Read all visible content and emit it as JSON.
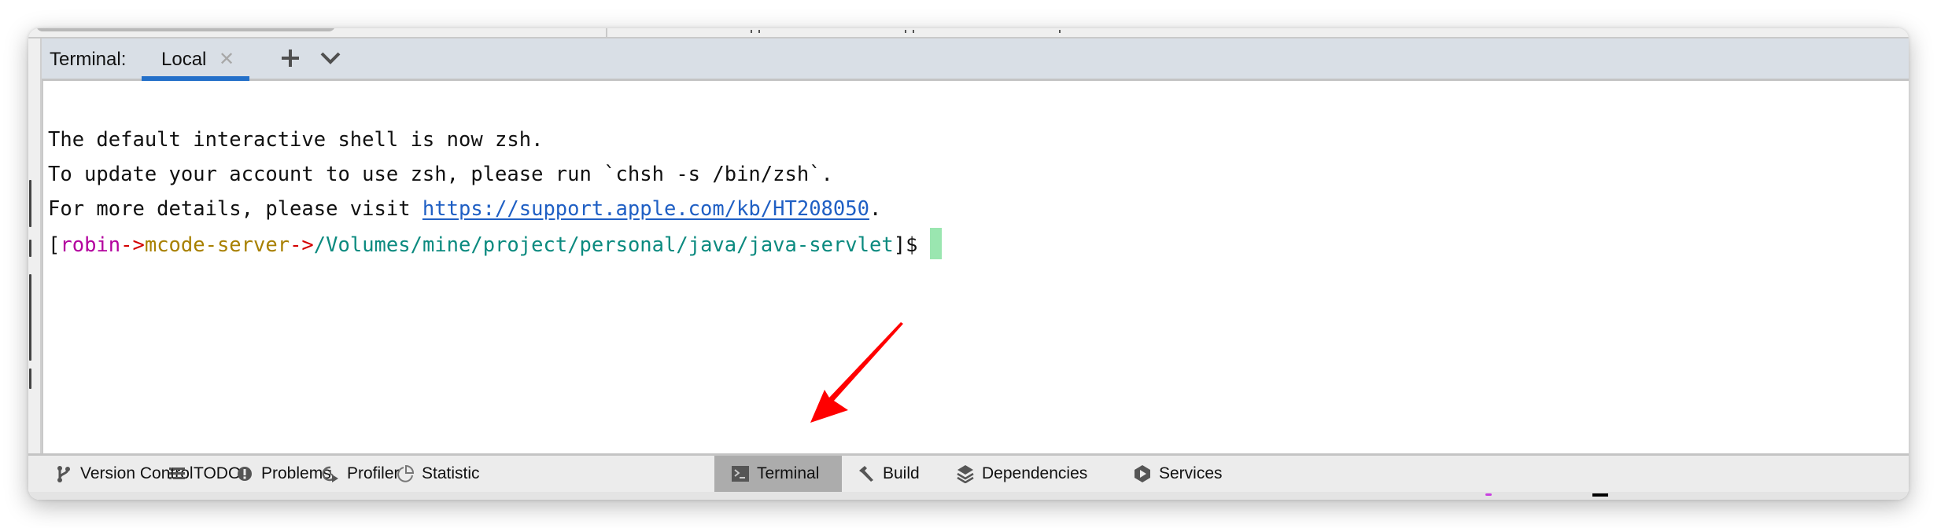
{
  "terminal_panel": {
    "label": "Terminal:",
    "tabs": [
      {
        "label": "Local",
        "active": true,
        "close_icon": "close-icon"
      }
    ],
    "add_tab_icon": "plus-icon",
    "more_tabs_icon": "chevron-down-icon"
  },
  "terminal_output": {
    "lines": [
      "The default interactive shell is now zsh.",
      "To update your account to use zsh, please run `chsh -s /bin/zsh`."
    ],
    "details_prefix": "For more details, please visit ",
    "details_link": "https://support.apple.com/kb/HT208050",
    "details_suffix": ".",
    "prompt": {
      "open_bracket": "[",
      "user": "robin",
      "sep1": "->",
      "host": "mcode-server",
      "sep2": "->",
      "path": "/Volumes/mine/project/personal/java/java-servlet",
      "close": "]$"
    },
    "colors": {
      "user": "#b3009e",
      "separator": "#d40000",
      "host": "#a88000",
      "path": "#0b8a7f",
      "link": "#1f5fc4",
      "cursor": "#9ae6b0"
    }
  },
  "annotation": {
    "type": "red-arrow",
    "points_to": "Terminal",
    "color": "#ff0000"
  },
  "tool_windows": [
    {
      "label": "Version Control",
      "icon": "branch-icon",
      "active": false
    },
    {
      "label": "TODO",
      "icon": "list-icon",
      "active": false
    },
    {
      "label": "Problems",
      "icon": "exclamation-circle-icon",
      "active": false
    },
    {
      "label": "Profiler",
      "icon": "profiler-icon",
      "active": false
    },
    {
      "label": "Statistic",
      "icon": "pie-chart-icon",
      "active": false
    },
    {
      "label": "Terminal",
      "icon": "terminal-icon",
      "active": true
    },
    {
      "label": "Build",
      "icon": "hammer-icon",
      "active": false
    },
    {
      "label": "Dependencies",
      "icon": "layers-icon",
      "active": false
    },
    {
      "label": "Services",
      "icon": "services-icon",
      "active": false
    }
  ],
  "accent_color": "#2470c9"
}
